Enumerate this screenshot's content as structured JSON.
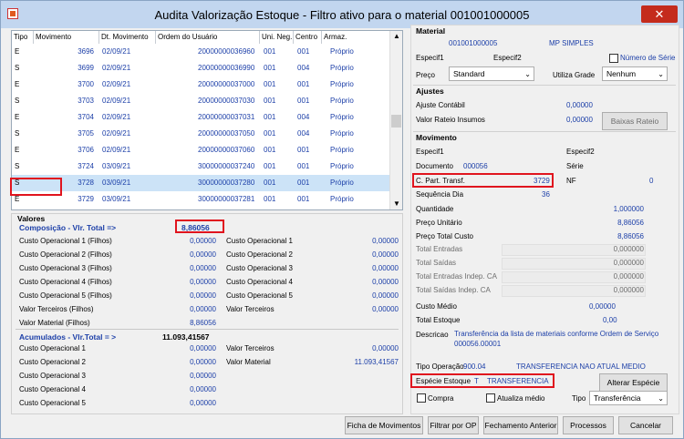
{
  "window": {
    "title": "Audita Valorização Estoque - Filtro ativo para o material 001001000005",
    "close_glyph": "✕"
  },
  "grid": {
    "columns": [
      "Tipo",
      "Movimento",
      "Dt. Movimento",
      "Ordem do Usuário",
      "Uni. Neg.",
      "Centro",
      "Armaz."
    ],
    "rows": [
      {
        "tipo": "E",
        "mov": "3696",
        "dt": "02/09/21",
        "ordem": "20000000036960",
        "un": "001",
        "centro": "001",
        "armaz": "Próprio"
      },
      {
        "tipo": "S",
        "mov": "3699",
        "dt": "02/09/21",
        "ordem": "20000000036990",
        "un": "001",
        "centro": "004",
        "armaz": "Próprio"
      },
      {
        "tipo": "E",
        "mov": "3700",
        "dt": "02/09/21",
        "ordem": "20000000037000",
        "un": "001",
        "centro": "001",
        "armaz": "Próprio"
      },
      {
        "tipo": "S",
        "mov": "3703",
        "dt": "02/09/21",
        "ordem": "20000000037030",
        "un": "001",
        "centro": "001",
        "armaz": "Próprio"
      },
      {
        "tipo": "E",
        "mov": "3704",
        "dt": "02/09/21",
        "ordem": "20000000037031",
        "un": "001",
        "centro": "004",
        "armaz": "Próprio"
      },
      {
        "tipo": "S",
        "mov": "3705",
        "dt": "02/09/21",
        "ordem": "20000000037050",
        "un": "001",
        "centro": "004",
        "armaz": "Próprio"
      },
      {
        "tipo": "E",
        "mov": "3706",
        "dt": "02/09/21",
        "ordem": "20000000037060",
        "un": "001",
        "centro": "001",
        "armaz": "Próprio"
      },
      {
        "tipo": "S",
        "mov": "3724",
        "dt": "03/09/21",
        "ordem": "30000000037240",
        "un": "001",
        "centro": "001",
        "armaz": "Próprio"
      },
      {
        "tipo": "S",
        "mov": "3728",
        "dt": "03/09/21",
        "ordem": "30000000037280",
        "un": "001",
        "centro": "001",
        "armaz": "Próprio"
      },
      {
        "tipo": "E",
        "mov": "3729",
        "dt": "03/09/21",
        "ordem": "30000000037281",
        "un": "001",
        "centro": "001",
        "armaz": "Próprio"
      }
    ]
  },
  "valores": {
    "title": "Valores",
    "composicao_label": "Composição - Vlr. Total =>",
    "composicao_value": "8,86056",
    "left": [
      {
        "label": "Custo Operacional 1 (Filhos)",
        "value": "0,00000"
      },
      {
        "label": "Custo Operacional 2 (Filhos)",
        "value": "0,00000"
      },
      {
        "label": "Custo Operacional 3 (Filhos)",
        "value": "0,00000"
      },
      {
        "label": "Custo Operacional 4 (Filhos)",
        "value": "0,00000"
      },
      {
        "label": "Custo Operacional 5 (Filhos)",
        "value": "0,00000"
      },
      {
        "label": "Valor Terceiros (Filhos)",
        "value": "0,00000"
      },
      {
        "label": "Valor Material (Filhos)",
        "value": "8,86056"
      }
    ],
    "right": [
      {
        "label": "Custo Operacional 1",
        "value": "0,00000"
      },
      {
        "label": "Custo Operacional 2",
        "value": "0,00000"
      },
      {
        "label": "Custo Operacional 3",
        "value": "0,00000"
      },
      {
        "label": "Custo Operacional 4",
        "value": "0,00000"
      },
      {
        "label": "Custo Operacional 5",
        "value": "0,00000"
      },
      {
        "label": "Valor Terceiros",
        "value": "0,00000"
      }
    ],
    "acumulados_label": "Acumulados - Vlr.Total = >",
    "acumulados_value": "11.093,41567",
    "acc_left": [
      {
        "label": "Custo Operacional 1",
        "value": "0,00000"
      },
      {
        "label": "Custo Operacional 2",
        "value": "0,00000"
      },
      {
        "label": "Custo Operacional 3",
        "value": "0,00000"
      },
      {
        "label": "Custo Operacional 4",
        "value": "0,00000"
      },
      {
        "label": "Custo Operacional 5",
        "value": "0,00000"
      }
    ],
    "acc_right": [
      {
        "label": "Valor Terceiros",
        "value": "0,00000"
      },
      {
        "label": "Valor Material",
        "value": "11.093,41567"
      }
    ]
  },
  "material": {
    "title": "Material",
    "code": "001001000005",
    "name": "MP SIMPLES",
    "especif1": "Especif1",
    "especif2": "Especif2",
    "numero_serie": "Número de Série",
    "preco_label": "Preço",
    "preco_value": "Standard",
    "utiliza_grade_label": "Utiliza Grade",
    "utiliza_grade_value": "Nenhum"
  },
  "ajustes": {
    "title": "Ajustes",
    "contabil_label": "Ajuste Contábil",
    "contabil_value": "0,00000",
    "rateio_label": "Valor Rateio Insumos",
    "rateio_value": "0,00000",
    "baixas_button": "Baixas Rateio"
  },
  "movimento": {
    "title": "Movimento",
    "especif1": "Especif1",
    "especif2": "Especif2",
    "documento_label": "Documento",
    "documento_value": "000056",
    "serie_label": "Série",
    "cpart_label": "C. Part. Transf.",
    "cpart_value": "3729",
    "nf_label": "NF",
    "nf_value": "0",
    "seq_label": "Sequência Dia",
    "seq_value": "36",
    "fields": [
      {
        "label": "Quantidade",
        "value": "1,000000"
      },
      {
        "label": "Preço Unitário",
        "value": "8,86056"
      },
      {
        "label": "Preço Total Custo",
        "value": "8,86056"
      }
    ],
    "disabled": [
      {
        "label": "Total Entradas",
        "value": "0,000000"
      },
      {
        "label": "Total Saídas",
        "value": "0,000000"
      },
      {
        "label": "Total Entradas Indep. CA",
        "value": "0,000000"
      },
      {
        "label": "Total Saídas Indep. CA",
        "value": "0,000000"
      }
    ],
    "custo_medio_label": "Custo Médio",
    "custo_medio_value": "0,00000",
    "total_estoque_label": "Total Estoque",
    "total_estoque_value": "0,00",
    "descricao_label": "Descricao",
    "descricao_line1": "Transferência da lista de materiais conforme Ordem de Serviço",
    "descricao_line2": "000056.00001",
    "tipo_op_label": "Tipo Operação",
    "tipo_op_code": "900.04",
    "tipo_op_name": "TRANSFERENCIA NAO ATUAL MEDIO",
    "especie_label": "Espécie Estoque",
    "especie_code": "T",
    "especie_name": "TRANSFERENCIA",
    "alterar_button": "Alterar Espécie",
    "compra_label": "Compra",
    "atualiza_label": "Atualiza médio",
    "tipo_label": "Tipo",
    "tipo_value": "Transferência"
  },
  "buttons": {
    "ficha": "Ficha de Movimentos",
    "filtrar": "Filtrar por OP",
    "fechamento": "Fechamento Anterior",
    "processos": "Processos",
    "cancelar": "Cancelar"
  }
}
